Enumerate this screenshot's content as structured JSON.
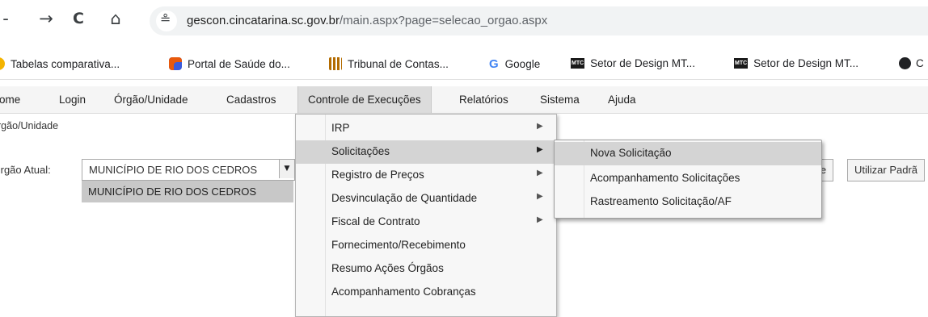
{
  "browser": {
    "back_glyph": "-",
    "forward_glyph": "→",
    "reload_glyph": "C",
    "home_glyph": "⌂",
    "site_info_glyph": "≗",
    "url_host": "gescon.cincatarina.sc.gov.br",
    "url_path": "/main.aspx?page=selecao_orgao.aspx",
    "bookmarks": [
      {
        "label": "Tabelas comparativa...",
        "icon": "bookmark-icon",
        "color": "#f4b400"
      },
      {
        "label": "Portal de Saúde do...",
        "icon": "puzzle-icon",
        "color": "#3b5bdb"
      },
      {
        "label": "Tribunal de Contas...",
        "icon": "columns-icon",
        "color": "#b36b00"
      },
      {
        "label": "Google",
        "icon": "google-icon",
        "color": "#4285f4",
        "glyph": "G"
      },
      {
        "label": "Setor de Design MT...",
        "icon": "mtc-icon",
        "color": "#1a1a1a",
        "glyph": "MTC"
      },
      {
        "label": "Setor de Design MT...",
        "icon": "mtc-icon",
        "color": "#1a1a1a",
        "glyph": "MTC"
      },
      {
        "label": "C",
        "icon": "globe-icon",
        "color": "#202124"
      }
    ]
  },
  "menubar": {
    "items": [
      "ome",
      "Login",
      "Órgão/Unidade",
      "Cadastros",
      "Controle de Execuções",
      "Relatórios",
      "Sistema",
      "Ajuda"
    ]
  },
  "page": {
    "breadcrumb": "rgão/Unidade",
    "orgao_label": "Irgão Atual:",
    "orgao_selected": "MUNICÍPIO DE RIO DOS CEDROS",
    "orgao_option": "MUNICÍPIO DE RIO DOS CEDROS",
    "partial_button": "le",
    "default_button": "Utilizar Padrã"
  },
  "dropdown": {
    "items": [
      {
        "label": "IRP",
        "submenu": true
      },
      {
        "label": "Solicitações",
        "submenu": true,
        "highlighted": true
      },
      {
        "label": "Registro de Preços",
        "submenu": true
      },
      {
        "label": "Desvinculação de Quantidade",
        "submenu": true
      },
      {
        "label": "Fiscal de Contrato",
        "submenu": true
      },
      {
        "label": "Fornecimento/Recebimento",
        "submenu": false
      },
      {
        "label": "Resumo Ações Órgãos",
        "submenu": false
      },
      {
        "label": "Acompanhamento Cobranças",
        "submenu": false
      }
    ]
  },
  "submenu": {
    "items": [
      {
        "label": "Nova Solicitação",
        "highlighted": true
      },
      {
        "label": "Acompanhamento Solicitações"
      },
      {
        "label": "Rastreamento Solicitação/AF"
      }
    ]
  },
  "colors": {
    "highlight": "#d4d4d4",
    "menubar_bg": "#f5f5f5"
  }
}
